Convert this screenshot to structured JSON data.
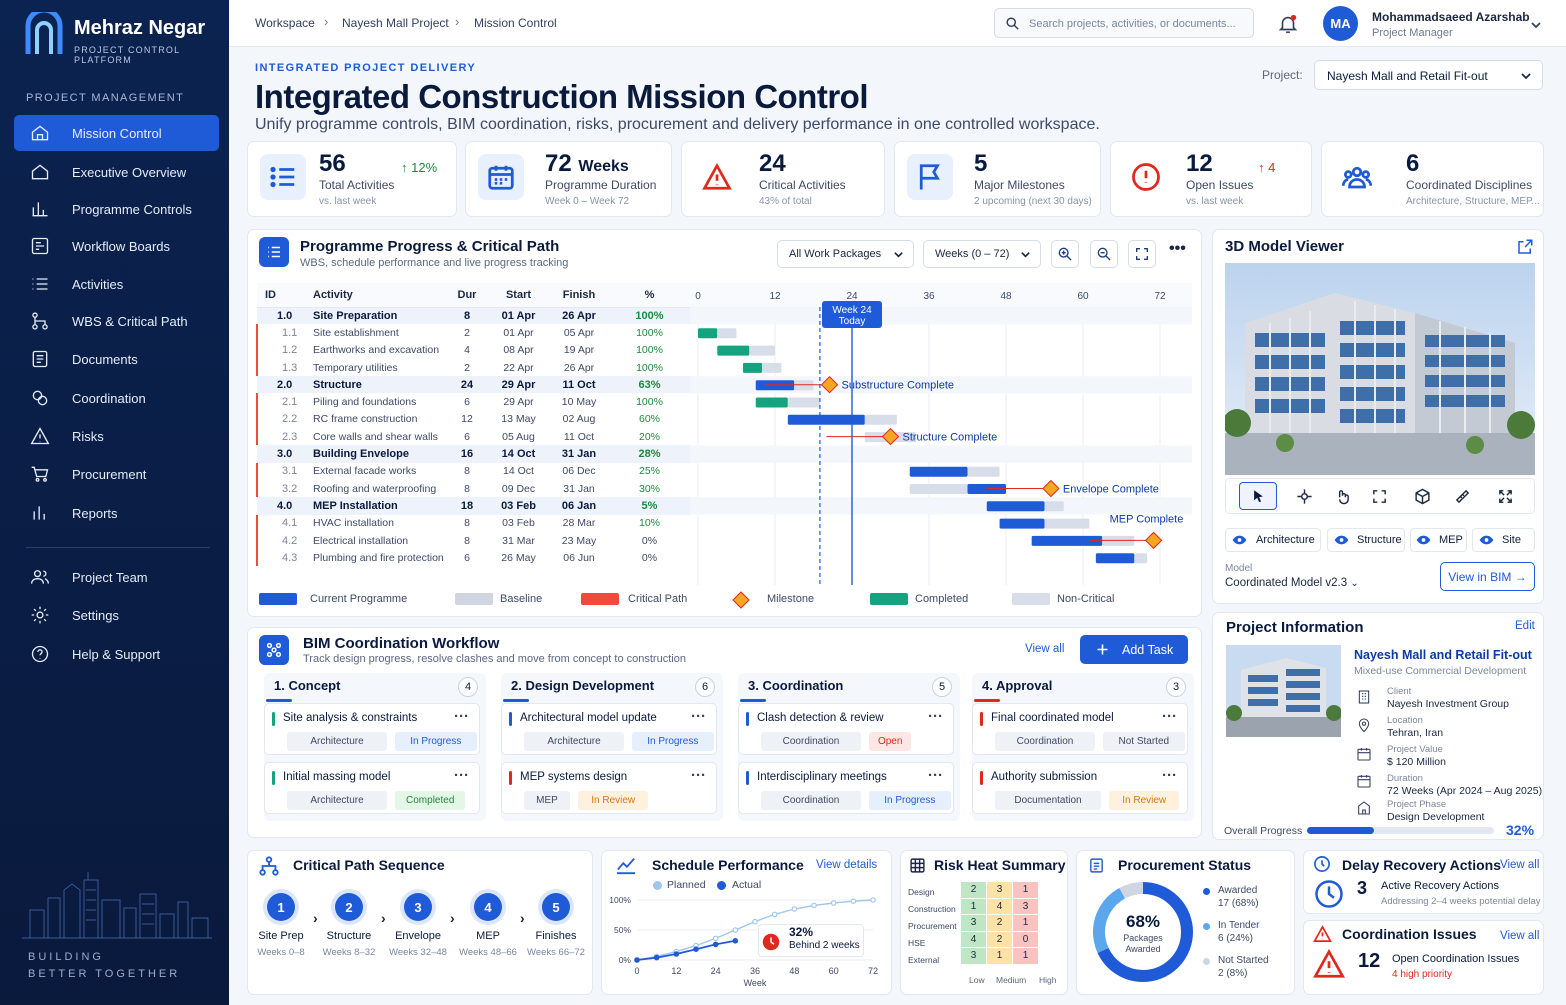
{
  "brand": {
    "name": "Mehraz Negar",
    "sub": "PROJECT CONTROL PLATFORM",
    "tag1": "BUILDING",
    "tag2": "BETTER TOGETHER"
  },
  "nav": {
    "section": "PROJECT MANAGEMENT",
    "items": [
      "Mission Control",
      "Executive Overview",
      "Programme Controls",
      "Workflow Boards",
      "Activities",
      "WBS & Critical Path",
      "Documents",
      "Coordination",
      "Risks",
      "Procurement",
      "Reports"
    ],
    "bottom": [
      "Project Team",
      "Settings",
      "Help & Support"
    ]
  },
  "breadcrumb": [
    "Workspace",
    "Nayesh Mall Project",
    "Mission Control"
  ],
  "search": {
    "placeholder": "Search projects, activities, or documents..."
  },
  "user": {
    "initials": "MA",
    "name": "Mohammadsaeed Azarshab",
    "role": "Project Manager"
  },
  "header": {
    "eyebrow": "INTEGRATED PROJECT DELIVERY",
    "title": "Integrated Construction Mission Control",
    "subtitle": "Unify programme controls, BIM coordination, risks, procurement and delivery performance in one controlled workspace.",
    "project_label": "Project:",
    "project": "Nayesh Mall and Retail Fit-out"
  },
  "kpis": [
    {
      "value": "56",
      "label": "Total Activities",
      "sub": "vs. last week",
      "trend": "↑ 12%"
    },
    {
      "value": "72",
      "unit": "Weeks",
      "label": "Programme Duration",
      "sub": "Week 0 – Week 72"
    },
    {
      "value": "24",
      "label": "Critical Activities",
      "sub": "43% of total"
    },
    {
      "value": "5",
      "label": "Major Milestones",
      "sub": "2 upcoming (next 30 days)"
    },
    {
      "value": "12",
      "label": "Open Issues",
      "sub": "vs. last week",
      "trend": "↑ 4"
    },
    {
      "value": "6",
      "label": "Coordinated Disciplines",
      "sub": "Architecture, Structure, MEP..."
    }
  ],
  "programme": {
    "title": "Programme Progress & Critical Path",
    "subtitle": "WBS, schedule performance and live progress tracking",
    "filter": "All Work Packages",
    "range": "Weeks (0 – 72)",
    "columns": [
      "ID",
      "Activity",
      "Dur",
      "Start",
      "Finish",
      "%"
    ],
    "rows": [
      {
        "id": "1.0",
        "name": "Site Preparation",
        "dur": "8",
        "start": "01 Apr",
        "finish": "26 Apr",
        "pct": "100%",
        "group": true
      },
      {
        "id": "1.1",
        "name": "Site establishment",
        "dur": "2",
        "start": "01 Apr",
        "finish": "05 Apr",
        "pct": "100%"
      },
      {
        "id": "1.2",
        "name": "Earthworks and excavation",
        "dur": "4",
        "start": "08 Apr",
        "finish": "19 Apr",
        "pct": "100%"
      },
      {
        "id": "1.3",
        "name": "Temporary utilities",
        "dur": "2",
        "start": "22 Apr",
        "finish": "26 Apr",
        "pct": "100%"
      },
      {
        "id": "2.0",
        "name": "Structure",
        "dur": "24",
        "start": "29 Apr",
        "finish": "11 Oct",
        "pct": "63%",
        "group": true
      },
      {
        "id": "2.1",
        "name": "Piling and foundations",
        "dur": "6",
        "start": "29 Apr",
        "finish": "10 May",
        "pct": "100%"
      },
      {
        "id": "2.2",
        "name": "RC frame construction",
        "dur": "12",
        "start": "13 May",
        "finish": "02 Aug",
        "pct": "60%"
      },
      {
        "id": "2.3",
        "name": "Core walls and shear walls",
        "dur": "6",
        "start": "05 Aug",
        "finish": "11 Oct",
        "pct": "20%"
      },
      {
        "id": "3.0",
        "name": "Building Envelope",
        "dur": "16",
        "start": "14 Oct",
        "finish": "31 Jan",
        "pct": "28%",
        "group": true
      },
      {
        "id": "3.1",
        "name": "External facade works",
        "dur": "8",
        "start": "14 Oct",
        "finish": "06 Dec",
        "pct": "25%"
      },
      {
        "id": "3.2",
        "name": "Roofing and waterproofing",
        "dur": "8",
        "start": "09 Dec",
        "finish": "31 Jan",
        "pct": "30%"
      },
      {
        "id": "4.0",
        "name": "MEP Installation",
        "dur": "18",
        "start": "03 Feb",
        "finish": "06 Jan",
        "pct": "5%",
        "group": true
      },
      {
        "id": "4.1",
        "name": "HVAC installation",
        "dur": "8",
        "start": "03 Feb",
        "finish": "28 Mar",
        "pct": "10%"
      },
      {
        "id": "4.2",
        "name": "Electrical installation",
        "dur": "8",
        "start": "31 Mar",
        "finish": "23 May",
        "pct": "0%"
      },
      {
        "id": "4.3",
        "name": "Plumbing and fire protection",
        "dur": "6",
        "start": "26 May",
        "finish": "06 Jun",
        "pct": "0%"
      }
    ],
    "weeks": [
      "0",
      "12",
      "24",
      "36",
      "48",
      "60",
      "72"
    ],
    "today": "Week 24\nToday",
    "milestones": [
      "Substructure Complete",
      "Structure Complete",
      "Envelope Complete",
      "MEP Complete"
    ],
    "legend": [
      "Current Programme",
      "Baseline",
      "Critical Path",
      "Milestone",
      "Completed",
      "Non-Critical"
    ]
  },
  "viewer": {
    "title": "3D Model Viewer",
    "layers": [
      "Architecture",
      "Structure",
      "MEP",
      "Site"
    ],
    "model_label": "Model",
    "model": "Coordinated Model v2.3",
    "button": "View in BIM →"
  },
  "info": {
    "title": "Project Information",
    "edit": "Edit",
    "name": "Nayesh Mall and Retail Fit-out",
    "type": "Mixed-use Commercial Development",
    "fields": [
      {
        "label": "Client",
        "value": "Nayesh Investment Group"
      },
      {
        "label": "Location",
        "value": "Tehran, Iran"
      },
      {
        "label": "Project Value",
        "value": "$ 120 Million"
      },
      {
        "label": "Duration",
        "value": "72 Weeks (Apr 2024 – Aug 2025)"
      },
      {
        "label": "Project Phase",
        "value": "Design Development"
      }
    ],
    "progress_label": "Overall Progress",
    "progress": "32%"
  },
  "bim": {
    "title": "BIM Coordination Workflow",
    "subtitle": "Track design progress, resolve clashes and move from concept to construction",
    "view_all": "View all",
    "add": "Add Task",
    "columns": [
      {
        "title": "1.  Concept",
        "count": "4",
        "cards": [
          {
            "title": "Site analysis & constraints",
            "tag": "Architecture",
            "status": "In Progress"
          },
          {
            "title": "Initial massing model",
            "tag": "Architecture",
            "status": "Completed"
          }
        ]
      },
      {
        "title": "2.  Design Development",
        "count": "6",
        "cards": [
          {
            "title": "Architectural model update",
            "tag": "Architecture",
            "status": "In Progress"
          },
          {
            "title": "MEP systems design",
            "tag": "MEP",
            "status": "In Review"
          }
        ]
      },
      {
        "title": "3.  Coordination",
        "count": "5",
        "cards": [
          {
            "title": "Clash detection & review",
            "tag": "Coordination",
            "status": "Open"
          },
          {
            "title": "Interdisciplinary meetings",
            "tag": "Coordination",
            "status": "In Progress"
          }
        ]
      },
      {
        "title": "4.  Approval",
        "count": "3",
        "cards": [
          {
            "title": "Final coordinated model",
            "tag": "Coordination",
            "status": "Not Started"
          },
          {
            "title": "Authority submission",
            "tag": "Documentation",
            "status": "In Review"
          }
        ]
      }
    ]
  },
  "critical_path": {
    "title": "Critical Path Sequence",
    "steps": [
      {
        "n": "1",
        "label": "Site Prep",
        "sub": "Weeks 0–8"
      },
      {
        "n": "2",
        "label": "Structure",
        "sub": "Weeks 8–32"
      },
      {
        "n": "3",
        "label": "Envelope",
        "sub": "Weeks 32–48"
      },
      {
        "n": "4",
        "label": "MEP",
        "sub": "Weeks 48–66"
      },
      {
        "n": "5",
        "label": "Finishes",
        "sub": "Weeks 66–72"
      }
    ]
  },
  "schedule": {
    "title": "Schedule Performance",
    "link": "View details",
    "planned": "Planned",
    "actual": "Actual",
    "value": "32%",
    "note": "Behind 2 weeks",
    "xlabel": "Week",
    "y_ticks": [
      "100%",
      "50%",
      "0%"
    ],
    "x_ticks": [
      "0",
      "12",
      "24",
      "36",
      "48",
      "60",
      "72"
    ]
  },
  "chart_data": {
    "type": "line",
    "title": "Schedule Performance",
    "xlabel": "Week",
    "ylabel": "",
    "ylim": [
      0,
      100
    ],
    "xlim": [
      0,
      72
    ],
    "x": [
      0,
      6,
      12,
      18,
      24,
      30,
      36,
      42,
      48,
      54,
      60,
      66,
      72
    ],
    "series": [
      {
        "name": "Planned",
        "values": [
          0,
          6,
          14,
          24,
          36,
          50,
          64,
          76,
          85,
          91,
          95,
          98,
          100
        ]
      },
      {
        "name": "Actual",
        "values": [
          0,
          4,
          10,
          18,
          26,
          32
        ]
      }
    ]
  },
  "risk": {
    "title": "Risk Heat Summary",
    "rows": [
      "Design",
      "Construction",
      "Procurement",
      "HSE",
      "External"
    ],
    "cols": [
      "Low",
      "Medium",
      "High"
    ],
    "values": [
      [
        "2",
        "3",
        "1"
      ],
      [
        "1",
        "4",
        "3"
      ],
      [
        "3",
        "2",
        "1"
      ],
      [
        "4",
        "2",
        "0"
      ],
      [
        "3",
        "1",
        "1"
      ]
    ]
  },
  "procurement": {
    "title": "Procurement Status",
    "pct": "68%",
    "center1": "Packages",
    "center2": "Awarded",
    "items": [
      {
        "label": "Awarded",
        "value": "17 (68%)"
      },
      {
        "label": "In Tender",
        "value": "6 (24%)"
      },
      {
        "label": "Not Started",
        "value": "2 (8%)"
      }
    ],
    "shares": [
      68,
      24,
      8
    ]
  },
  "delay": {
    "title": "Delay Recovery Actions",
    "link": "View all",
    "value": "3",
    "label": "Active Recovery Actions",
    "sub": "Addressing 2–4 weeks potential delay"
  },
  "coord": {
    "title": "Coordination Issues",
    "link": "View all",
    "value": "12",
    "label": "Open Coordination Issues",
    "sub": "4 high priority"
  },
  "colors": {
    "primary": "#1f5bd6",
    "critical": "#e0281e",
    "completed": "#14a37f",
    "baseline": "#cfd6e2",
    "milestone": "#f5a623"
  }
}
